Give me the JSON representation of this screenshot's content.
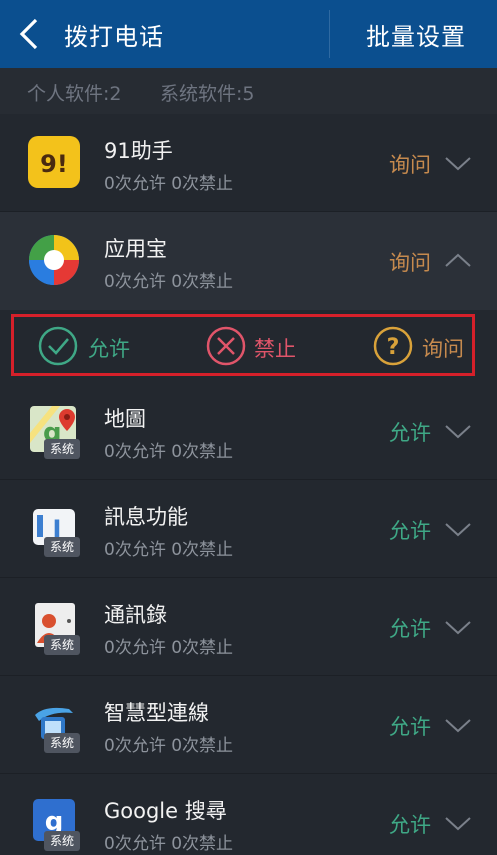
{
  "header": {
    "title": "拨打电话",
    "batch_label": "批量设置"
  },
  "summary": {
    "personal": "个人软件:2",
    "system": "系统软件:5"
  },
  "apps": [
    {
      "name": "91助手",
      "allowed": "0次允许",
      "denied": "0次禁止",
      "status": "询问",
      "system": false
    },
    {
      "name": "应用宝",
      "allowed": "0次允许",
      "denied": "0次禁止",
      "status": "询问",
      "system": false
    },
    {
      "name": "地圖",
      "allowed": "0次允许",
      "denied": "0次禁止",
      "status": "允许",
      "system": true
    },
    {
      "name": "訊息功能",
      "allowed": "0次允许",
      "denied": "0次禁止",
      "status": "允许",
      "system": true
    },
    {
      "name": "通訊錄",
      "allowed": "0次允许",
      "denied": "0次禁止",
      "status": "允许",
      "system": true
    },
    {
      "name": "智慧型連線",
      "allowed": "0次允许",
      "denied": "0次禁止",
      "status": "允许",
      "system": true
    },
    {
      "name": "Google 搜尋",
      "allowed": "0次允许",
      "denied": "0次禁止",
      "status": "允许",
      "system": true
    }
  ],
  "system_badge": "系统",
  "options": {
    "allow": "允许",
    "deny": "禁止",
    "ask": "询问"
  },
  "colors": {
    "header_bg": "#0b4f8f",
    "allow": "#3fa886",
    "deny": "#e0556a",
    "ask": "#c68a4e",
    "highlight": "#d5202a"
  }
}
